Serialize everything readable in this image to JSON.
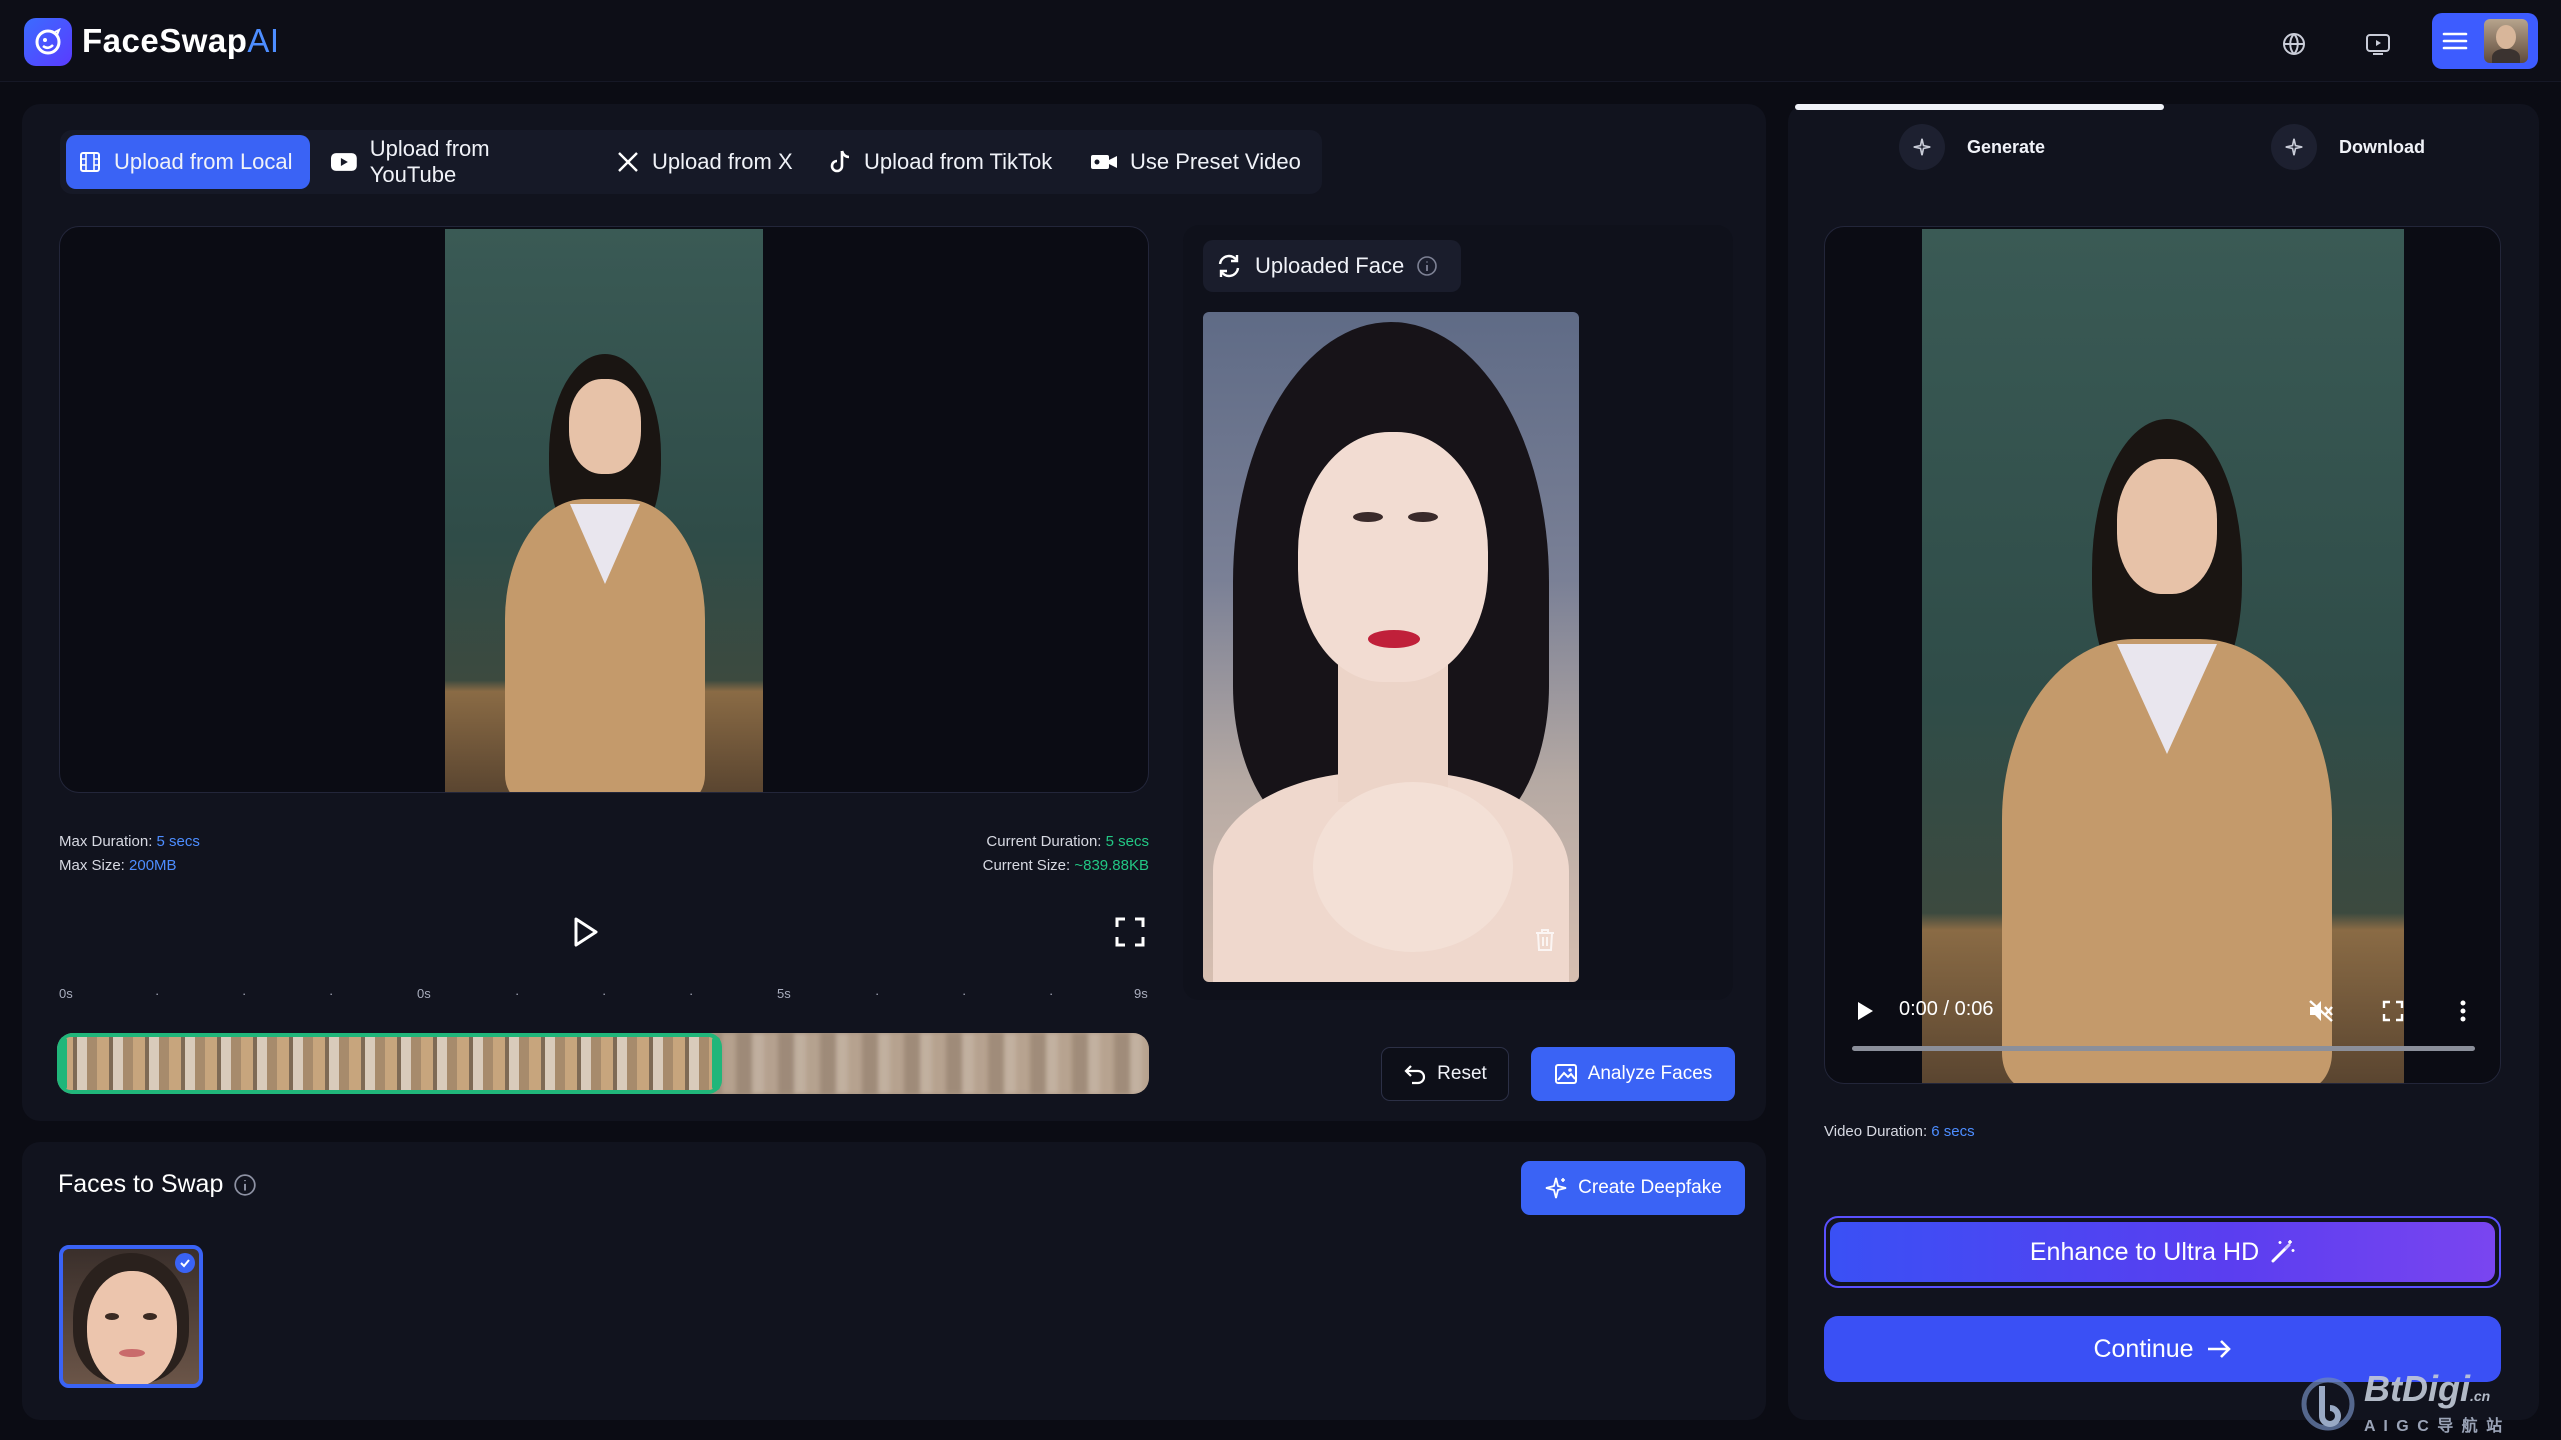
{
  "app": {
    "name_main": "FaceSwap",
    "name_accent": "AI"
  },
  "header": {
    "icons": [
      "translate-icon",
      "video-tutorial-icon",
      "menu-icon"
    ]
  },
  "upload_tabs": [
    {
      "label": "Upload from Local",
      "icon": "film-icon",
      "active": true
    },
    {
      "label": "Upload from YouTube",
      "icon": "youtube-icon",
      "active": false
    },
    {
      "label": "Upload from X",
      "icon": "x-logo-icon",
      "active": false
    },
    {
      "label": "Upload from TikTok",
      "icon": "tiktok-icon",
      "active": false
    },
    {
      "label": "Use Preset Video",
      "icon": "video-camera-icon",
      "active": false
    }
  ],
  "video_meta": {
    "max_duration_label": "Max Duration:",
    "max_duration_value": "5 secs",
    "max_size_label": "Max Size:",
    "max_size_value": "200MB",
    "current_duration_label": "Current Duration:",
    "current_duration_value": "5 secs",
    "current_size_label": "Current Size:",
    "current_size_value": "~839.88KB"
  },
  "timeline": {
    "ticks": [
      "0s",
      "·",
      "·",
      "·",
      "0s",
      "·",
      "·",
      "·",
      "5s",
      "·",
      "·",
      "·",
      "9s"
    ],
    "selection_fraction": 0.61
  },
  "uploaded_face": {
    "label": "Uploaded Face"
  },
  "actions": {
    "reset": "Reset",
    "analyze": "Analyze Faces"
  },
  "faces_to_swap": {
    "title": "Faces to Swap",
    "create_button": "Create Deepfake"
  },
  "steps": [
    {
      "label": "Generate",
      "active": true
    },
    {
      "label": "Download",
      "active": false
    }
  ],
  "player": {
    "time": "0:00 / 0:06"
  },
  "video_duration": {
    "label": "Video Duration:",
    "value": "6 secs"
  },
  "buttons": {
    "enhance": "Enhance to Ultra HD",
    "continue": "Continue"
  },
  "watermark": {
    "brand": "BtDigi",
    "suffix": ".cn",
    "sub": "A I G C 导 航 站"
  },
  "colors": {
    "accent": "#3a63f5",
    "green": "#20b67a",
    "link_blue": "#4d8dff"
  }
}
